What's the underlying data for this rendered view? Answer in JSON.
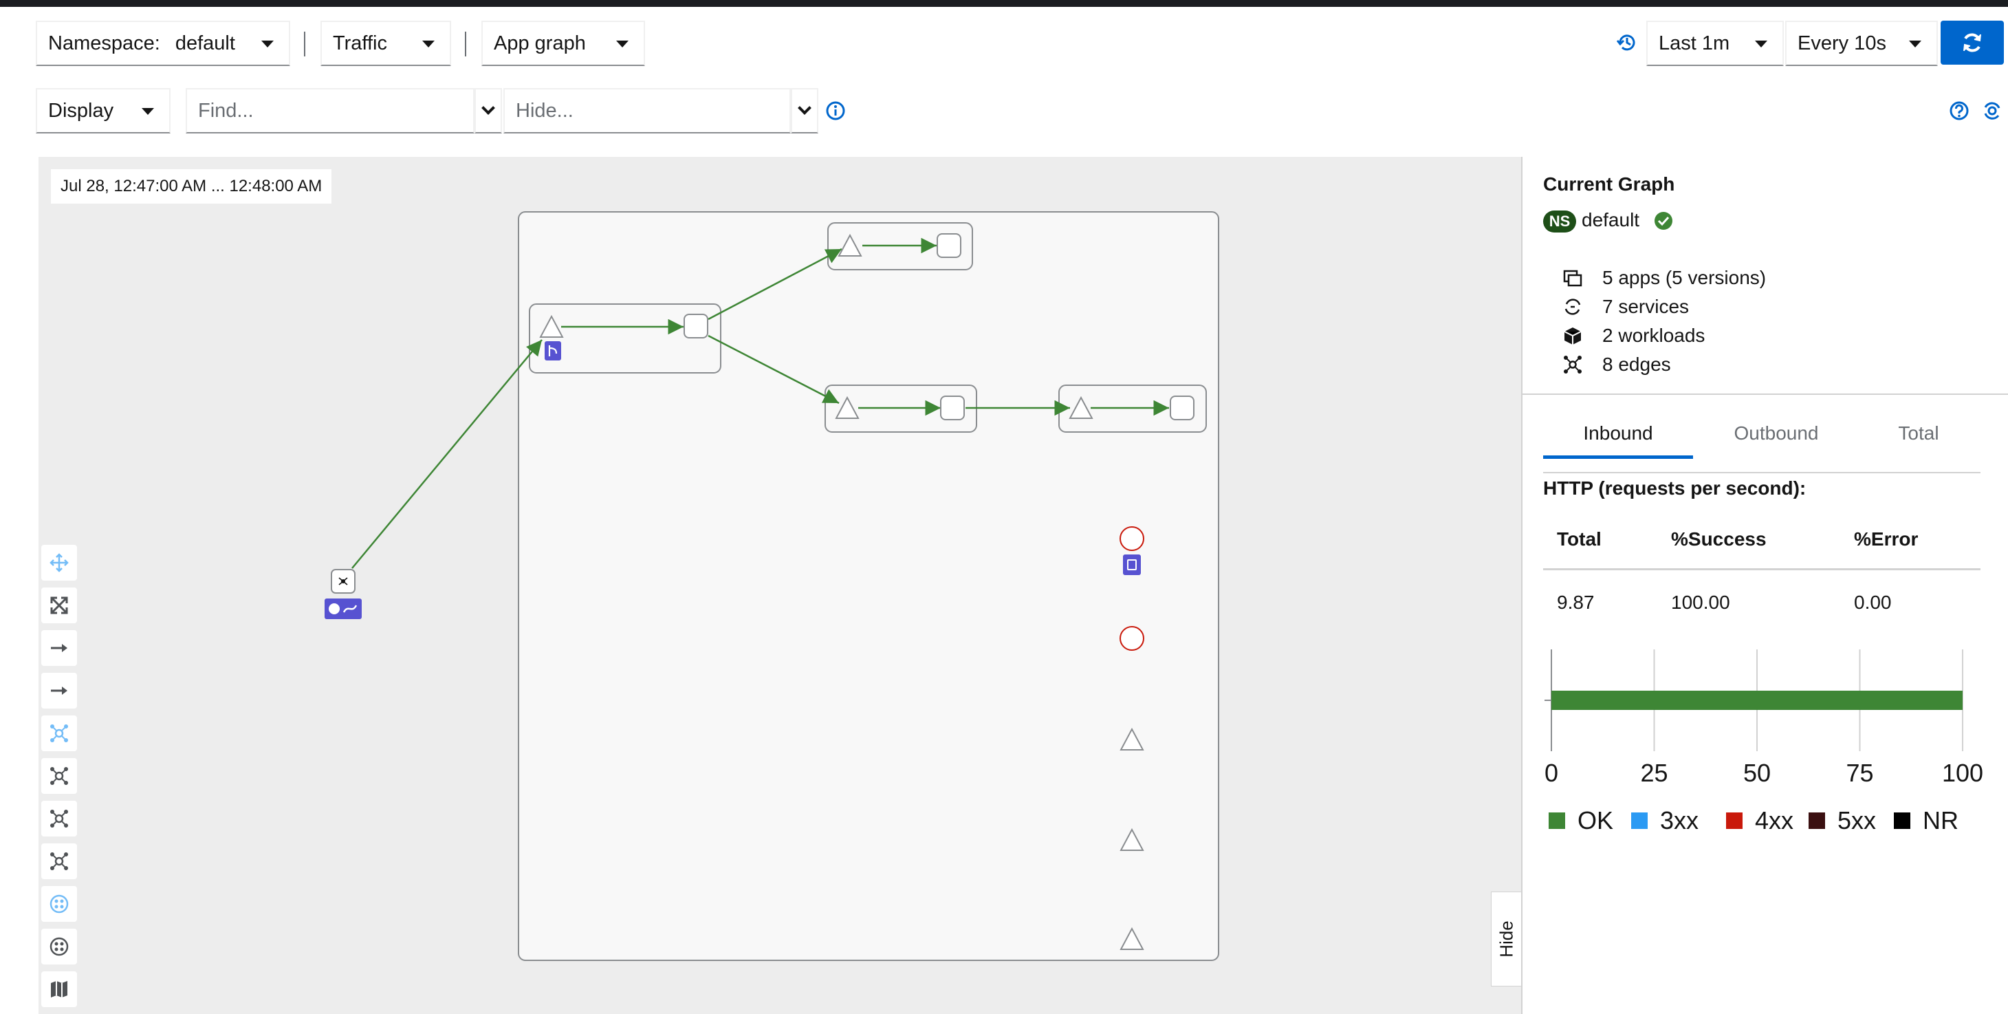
{
  "toolbar": {
    "namespace_label": "Namespace:",
    "namespace_value": "default",
    "traffic": "Traffic",
    "graph_type": "App graph",
    "time_range": "Last 1m",
    "refresh_interval": "Every 10s",
    "display": "Display",
    "find_placeholder": "Find...",
    "hide_placeholder": "Hide..."
  },
  "graph": {
    "timestamp": "Jul 28, 12:47:00 AM ... 12:48:00 AM",
    "hide_label": "Hide"
  },
  "panel": {
    "title": "Current Graph",
    "ns_badge": "NS",
    "namespace": "default",
    "stats": {
      "apps": "5 apps (5 versions)",
      "services": "7 services",
      "workloads": "2 workloads",
      "edges": "8 edges"
    },
    "tabs": [
      "Inbound",
      "Outbound",
      "Total"
    ],
    "http_title": "HTTP (requests per second):",
    "table": {
      "headers": [
        "Total",
        "%Success",
        "%Error"
      ],
      "values": [
        "9.87",
        "100.00",
        "0.00"
      ]
    }
  },
  "chart_data": {
    "type": "bar",
    "orientation": "horizontal",
    "categories": [
      ""
    ],
    "series": [
      {
        "name": "OK",
        "values": [
          100
        ]
      },
      {
        "name": "3xx",
        "values": [
          0
        ]
      },
      {
        "name": "4xx",
        "values": [
          0
        ]
      },
      {
        "name": "5xx",
        "values": [
          0
        ]
      },
      {
        "name": "NR",
        "values": [
          0
        ]
      }
    ],
    "xlim": [
      0,
      100
    ],
    "xticks": [
      "0",
      "25",
      "50",
      "75",
      "100"
    ],
    "colors": {
      "OK": "#3e8635",
      "3xx": "#2b9af3",
      "4xx": "#c9190b",
      "5xx": "#3b1011",
      "NR": "#000000"
    },
    "grid": true,
    "legend": "bottom"
  },
  "colors": {
    "accent": "#0066cc",
    "edge": "#3e8635",
    "node_badge": "#5752d1"
  }
}
